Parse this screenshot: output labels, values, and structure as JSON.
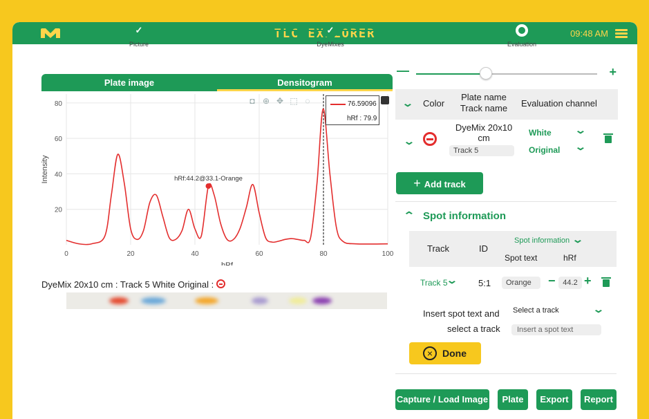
{
  "header": {
    "title": "TLC EXPLORER",
    "time": "09:48 AM",
    "logo_icon": "m-logo-icon",
    "menu_icon": "hamburger-icon"
  },
  "steps": [
    {
      "label": "Picture"
    },
    {
      "label": "DyeMixes"
    },
    {
      "label": "Evaluation"
    }
  ],
  "tabs": {
    "plate_image": "Plate image",
    "densitogram": "Densitogram"
  },
  "tooltip": {
    "value": "76.59096",
    "hrf": "hRf : 79.9"
  },
  "annotation": "hRf:44.2@33.1-Orange",
  "chart_data": {
    "type": "line",
    "xlabel": "hRf",
    "ylabel": "Intensity",
    "xlim": [
      0,
      100
    ],
    "ylim": [
      0,
      85
    ],
    "x_ticks": [
      0,
      20,
      40,
      60,
      80,
      100
    ],
    "y_ticks": [
      20,
      40,
      60,
      80
    ],
    "series": [
      {
        "color": "#e32d2d",
        "x": [
          0,
          4,
          8,
          12,
          14,
          16,
          18,
          20,
          22,
          24,
          26,
          28,
          30,
          32,
          34,
          36,
          38,
          40,
          42,
          44.2,
          46,
          48,
          50,
          52,
          54,
          56,
          58,
          60,
          62,
          64,
          66,
          68,
          70,
          72,
          74,
          76,
          78,
          79.9,
          82,
          84,
          86,
          90,
          100
        ],
        "y": [
          2.5,
          0.5,
          0.6,
          5,
          28,
          51,
          35,
          9,
          3,
          8,
          24,
          28,
          16,
          4,
          3,
          8,
          20,
          9,
          5,
          33.1,
          28,
          12,
          3,
          3,
          9,
          21,
          34,
          18,
          4,
          1.5,
          2,
          3,
          3.5,
          3,
          2.5,
          4,
          35,
          76.6,
          40,
          10,
          2,
          0.5,
          0.5
        ]
      }
    ],
    "marker": {
      "x": 44.2,
      "y": 33.1,
      "label": "hRf:44.2@33.1-Orange"
    },
    "vline_x": 80
  },
  "track_caption": "DyeMix 20x10 cm : Track 5 White Original :",
  "strip_colors": [
    "#e5492e",
    "#6aa8d9",
    "#f4a629",
    "#a89ad0",
    "#f0ec9a",
    "#8a3fb0"
  ],
  "track_table": {
    "col_color": "Color",
    "col_plate": "Plate name",
    "col_track": "Track name",
    "col_channel": "Evaluation channel",
    "plate_name": "DyeMix 20x10 cm",
    "track_name": "Track 5",
    "channel": "White",
    "mode": "Original"
  },
  "add_track": "Add track",
  "spot": {
    "section_title": "Spot information",
    "col_track": "Track",
    "col_id": "ID",
    "col_spot_info": "Spot information",
    "col_spot_text": "Spot text",
    "col_hrf": "hRf",
    "row_track": "Track 5",
    "row_id": "5:1",
    "row_text": "Orange",
    "row_hrf": "44.2",
    "insert_line1": "Insert spot text and",
    "insert_line2": "select a track",
    "select_placeholder": "Select a track",
    "text_placeholder": "Insert a spot text"
  },
  "done": "Done",
  "footer": {
    "capture": "Capture / Load Image",
    "plate": "Plate",
    "export": "Export",
    "report": "Report"
  },
  "colors": {
    "brand_green": "#1e9a57",
    "accent_yellow": "#f7c81e",
    "line_red": "#e32d2d"
  }
}
